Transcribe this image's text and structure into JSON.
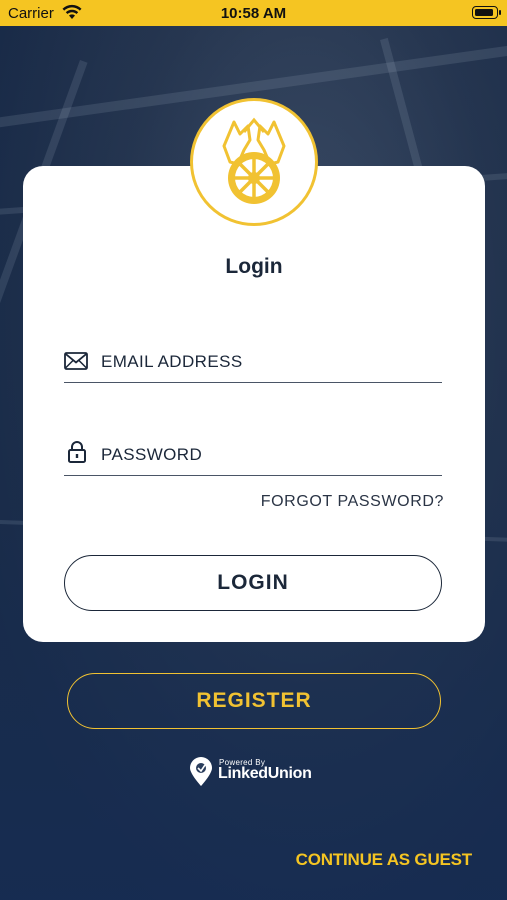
{
  "status_bar": {
    "carrier": "Carrier",
    "time": "10:58 AM"
  },
  "card": {
    "title": "Login",
    "email_placeholder": "EMAIL ADDRESS",
    "password_placeholder": "PASSWORD",
    "forgot_password": "FORGOT PASSWORD?",
    "login_button": "LOGIN"
  },
  "register_button": "REGISTER",
  "powered_by": {
    "caption": "Powered By",
    "brand": "LinkedUnion"
  },
  "continue_as_guest": "CONTINUE AS GUEST",
  "icons": {
    "email": "envelope-icon",
    "password": "lock-icon",
    "logo": "union-horse-wheel-logo",
    "powered": "location-pin-icon"
  },
  "colors": {
    "accent": "#f1c232",
    "status_bar": "#f5c522",
    "text_dark": "#1b2739",
    "card_bg": "#ffffff"
  }
}
